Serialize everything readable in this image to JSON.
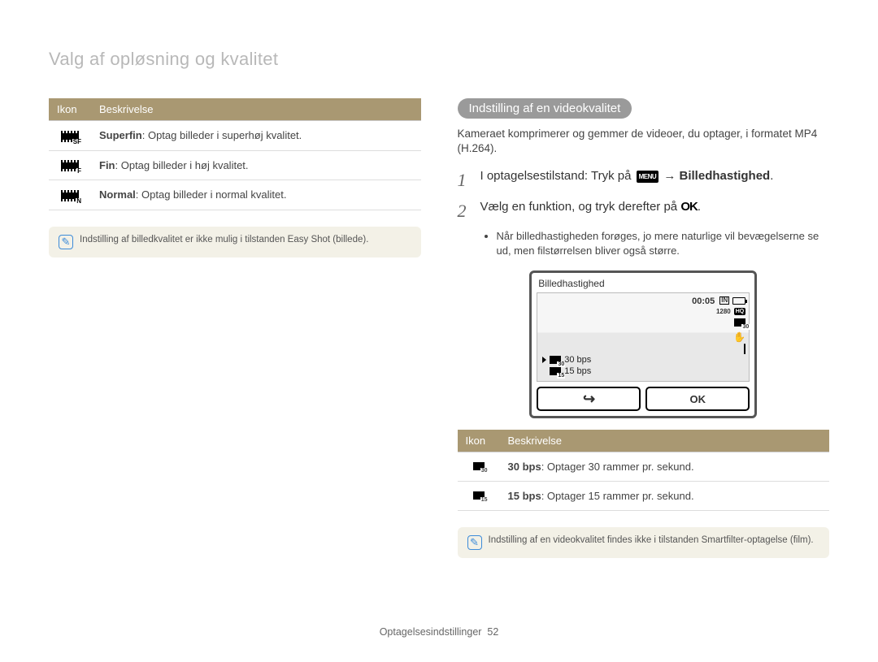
{
  "page_title": "Valg af opløsning og kvalitet",
  "left": {
    "table": {
      "headers": [
        "Ikon",
        "Beskrivelse"
      ],
      "rows": [
        {
          "icon_sub": "SF",
          "term": "Superfin",
          "desc": ": Optag billeder i superhøj kvalitet."
        },
        {
          "icon_sub": "F",
          "term": "Fin",
          "desc": ": Optag billeder i høj kvalitet."
        },
        {
          "icon_sub": "N",
          "term": "Normal",
          "desc": ": Optag billeder i normal kvalitet."
        }
      ]
    },
    "note": "Indstilling af billedkvalitet er ikke mulig i tilstanden Easy Shot (billede)."
  },
  "right": {
    "section_title": "Indstilling af en videokvalitet",
    "intro": "Kameraet komprimerer og gemmer de videoer, du optager, i formatet MP4 (H.264).",
    "step1_pre": "I optagelsestilstand: Tryk på ",
    "step1_menu": "MENU",
    "step1_arrow": " → ",
    "step1_bold": "Billedhastighed",
    "step1_end": ".",
    "step2_pre": "Vælg en funktion, og tryk derefter på ",
    "step2_ok": "OK",
    "step2_end": ".",
    "sub_bullet": "Når billedhastigheden forøges, jo mere naturlige vil bevægelserne se ud, men filstørrelsen bliver også større.",
    "screen": {
      "title": "Billedhastighed",
      "timer": "00:05",
      "res_badge": "1280",
      "hq_badge": "HQ",
      "list": [
        {
          "sub": "30",
          "label": "30 bps"
        },
        {
          "sub": "15",
          "label": "15 bps"
        }
      ],
      "btn_back_glyph": "↻",
      "btn_ok": "OK"
    },
    "table": {
      "headers": [
        "Ikon",
        "Beskrivelse"
      ],
      "rows": [
        {
          "icon_sub": "30",
          "term": "30 bps",
          "desc": ": Optager 30 rammer pr. sekund."
        },
        {
          "icon_sub": "15",
          "term": "15 bps",
          "desc": ": Optager 15 rammer pr. sekund."
        }
      ]
    },
    "note": "Indstilling af en videokvalitet findes ikke i tilstanden Smartfilter-optagelse (film)."
  },
  "footer": {
    "section": "Optagelsesindstillinger",
    "page_number": "52"
  }
}
